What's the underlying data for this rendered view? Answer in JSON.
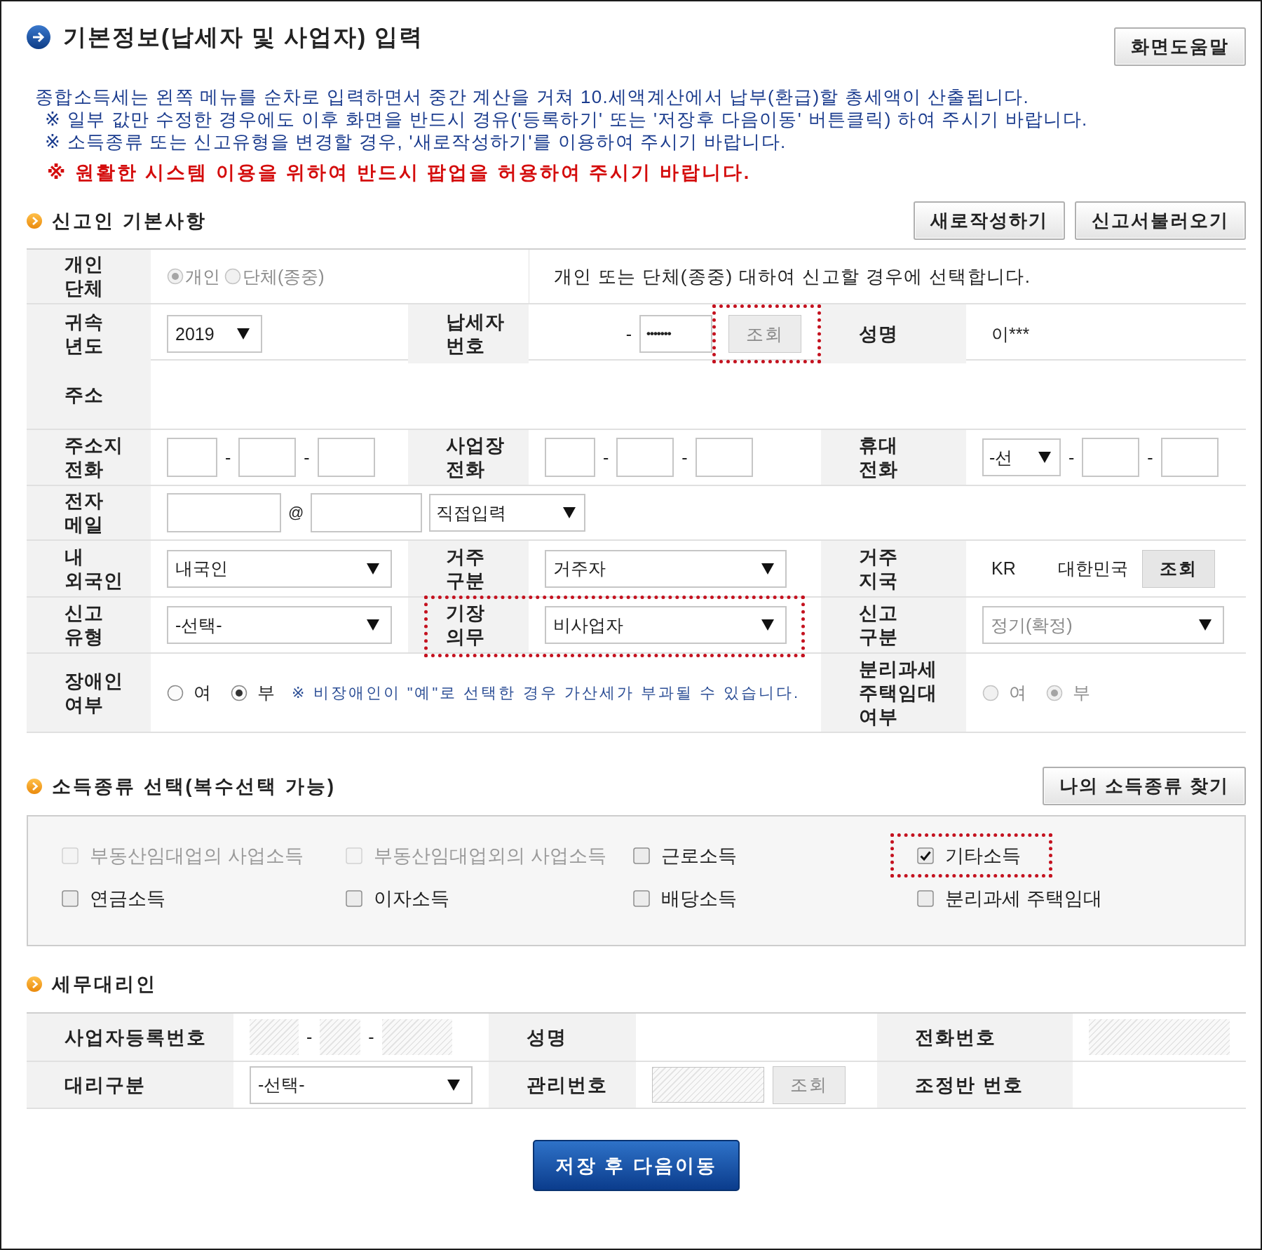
{
  "header": {
    "title": "기본정보(납세자 및 사업자) 입력",
    "help_button": "화면도움말"
  },
  "notice": {
    "lines": [
      "종합소득세는 왼쪽 메뉴를 순차로 입력하면서 중간 계산을 거쳐 10.세액계산에서 납부(환급)할 총세액이 산출됩니다.",
      "※ 일부 값만 수정한 경우에도 이후 화면을 반드시 경유('등록하기' 또는 '저장후 다음이동' 버튼클릭) 하여 주시기 바랍니다.",
      "※ 소득종류 또는 신고유형을 변경할 경우, '새로작성하기'를 이용하여 주시기 바랍니다."
    ],
    "warning": "※ 원활한 시스템 이용을 위하여 반드시 팝업을 허용하여 주시기 바랍니다."
  },
  "taxpayer": {
    "title": "신고인 기본사항",
    "buttons": [
      "새로작성하기",
      "신고서불러오기"
    ],
    "rows": [
      {
        "fields": [
          {
            "label": "개인\n단체",
            "highlighted": false,
            "control": {
              "kind": "radios",
              "disabled": true,
              "options": [
                {
                  "label": "개인",
                  "selected": true
                },
                {
                  "label": "단체(종중)",
                  "selected": false
                }
              ]
            },
            "hint": "개인 또는 단체(종중) 대하여 신고할 경우에 선택합니다."
          }
        ]
      },
      {
        "fields": [
          {
            "label": "귀속\n년도",
            "highlighted": false,
            "control": {
              "kind": "select",
              "value": "2019",
              "disabled": false
            }
          },
          {
            "label": "납세자\n번호",
            "highlighted": false,
            "control": {
              "kind": "id_lookup",
              "separator": "-",
              "masked": "•••••••",
              "button": "조회",
              "button_disabled": true,
              "highlighted": true
            }
          },
          {
            "label": "성명",
            "highlighted": false,
            "control": {
              "kind": "text",
              "value": "이***"
            }
          }
        ]
      },
      {
        "fields": [
          {
            "label": "주소",
            "highlighted": false
          }
        ]
      },
      {
        "fields": [
          {
            "label": "주소지\n전화",
            "highlighted": false,
            "control": {
              "kind": "split",
              "separator": "-",
              "parts": [
                {
                  "kind": "input"
                },
                {
                  "kind": "input"
                },
                {
                  "kind": "input"
                }
              ]
            }
          },
          {
            "label": "사업장\n전화",
            "highlighted": false,
            "control": {
              "kind": "split",
              "separator": "-",
              "parts": [
                {
                  "kind": "input"
                },
                {
                  "kind": "input"
                },
                {
                  "kind": "input"
                }
              ]
            }
          },
          {
            "label": "휴대\n전화",
            "highlighted": false,
            "control": {
              "kind": "split",
              "separator": "-",
              "parts": [
                {
                  "kind": "select",
                  "value": "-선",
                  "disabled": false
                },
                {
                  "kind": "input"
                },
                {
                  "kind": "input"
                }
              ]
            }
          }
        ]
      },
      {
        "fields": [
          {
            "label": "전자\n메일",
            "highlighted": false,
            "control": {
              "kind": "email",
              "at": "@",
              "domain": {
                "kind": "select",
                "value": "직접입력",
                "disabled": false
              }
            }
          }
        ]
      },
      {
        "fields": [
          {
            "label": "내\n외국인",
            "highlighted": false,
            "control": {
              "kind": "select",
              "value": "내국인",
              "disabled": false
            }
          },
          {
            "label": "거주\n구분",
            "highlighted": false,
            "control": {
              "kind": "select",
              "value": "거주자",
              "disabled": false
            }
          },
          {
            "label": "거주\n지국",
            "highlighted": false,
            "control": {
              "kind": "country",
              "code": "KR",
              "name": "대한민국",
              "button": "조회",
              "button_disabled": false
            }
          }
        ]
      },
      {
        "fields": [
          {
            "label": "신고\n유형",
            "highlighted": false,
            "control": {
              "kind": "select",
              "value": "-선택-",
              "disabled": false
            }
          },
          {
            "label": "기장\n의무",
            "highlighted": true,
            "control": {
              "kind": "select",
              "value": "비사업자",
              "disabled": false
            }
          },
          {
            "label": "신고\n구분",
            "highlighted": false,
            "control": {
              "kind": "select",
              "value": "정기(확정)",
              "disabled": true
            }
          }
        ]
      },
      {
        "fields": [
          {
            "label": "장애인\n여부",
            "highlighted": false,
            "control": {
              "kind": "radios",
              "disabled": false,
              "options": [
                {
                  "label": "여",
                  "selected": false
                },
                {
                  "label": "부",
                  "selected": true
                }
              ],
              "note": "※ 비장애인이 \"예\"로 선택한 경우 가산세가 부과될 수 있습니다."
            }
          },
          {
            "label": "분리과세\n주택임대\n여부",
            "highlighted": false,
            "control": {
              "kind": "radios",
              "disabled": true,
              "options": [
                {
                  "label": "여",
                  "selected": false
                },
                {
                  "label": "부",
                  "selected": true
                }
              ]
            }
          }
        ]
      }
    ]
  },
  "income": {
    "title": "소득종류 선택(복수선택 가능)",
    "button": "나의 소득종류 찾기",
    "options": [
      {
        "label": "부동산임대업의 사업소득",
        "checked": false,
        "disabled": true,
        "highlighted": false
      },
      {
        "label": "부동산임대업외의 사업소득",
        "checked": false,
        "disabled": true,
        "highlighted": false
      },
      {
        "label": "근로소득",
        "checked": false,
        "disabled": false,
        "highlighted": false
      },
      {
        "label": "기타소득",
        "checked": true,
        "disabled": false,
        "highlighted": true
      },
      {
        "label": "연금소득",
        "checked": false,
        "disabled": false,
        "highlighted": false
      },
      {
        "label": "이자소득",
        "checked": false,
        "disabled": false,
        "highlighted": false
      },
      {
        "label": "배당소득",
        "checked": false,
        "disabled": false,
        "highlighted": false
      },
      {
        "label": "분리과세 주택임대",
        "checked": false,
        "disabled": false,
        "highlighted": false
      }
    ]
  },
  "agent": {
    "title": "세무대리인",
    "rows": [
      {
        "fields": [
          {
            "label": "사업자등록번호",
            "control": {
              "kind": "split",
              "separator": "-",
              "parts": [
                {
                  "kind": "locked"
                },
                {
                  "kind": "locked"
                },
                {
                  "kind": "locked"
                }
              ]
            }
          },
          {
            "label": "성명"
          },
          {
            "label": "전화번호",
            "control": {
              "kind": "locked"
            }
          }
        ]
      },
      {
        "fields": [
          {
            "label": "대리구분",
            "control": {
              "kind": "select",
              "value": "-선택-",
              "disabled": false
            }
          },
          {
            "label": "관리번호",
            "control": {
              "kind": "locked_lookup",
              "button": "조회",
              "button_disabled": true
            }
          },
          {
            "label": "조정반 번호"
          }
        ]
      }
    ]
  },
  "save_button": "저장 후 다음이동"
}
